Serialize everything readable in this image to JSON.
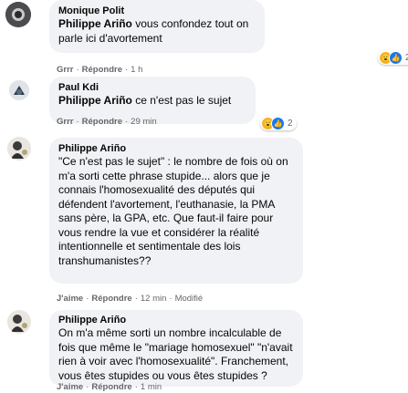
{
  "comments": [
    {
      "author": "Monique Polit",
      "mention": "Philippe Ariño",
      "text": " vous confondez tout on parle ici d'avortement",
      "actions": {
        "like": "Grrr",
        "reply": "Répondre",
        "time": "1 h"
      },
      "reaction_count": "2"
    },
    {
      "author": "Paul Kdi",
      "mention": "Philippe Ariño",
      "text": " ce n'est pas le sujet",
      "actions": {
        "like": "Grrr",
        "reply": "Répondre",
        "time": "29 min"
      },
      "reaction_count": "2"
    },
    {
      "author": "Philippe Ariño",
      "text": "\"Ce n'est pas le sujet\" : le nombre de fois où on m'a sorti cette phrase stupide... alors que je connais l'homosexualité des députés qui défendent l'avortement, l'euthanasie, la PMA sans père, la GPA, etc. Que faut-il faire pour vous rendre la vue et considérer la réalité intentionnelle et sentimentale des lois transhumanistes??",
      "actions": {
        "like": "J'aime",
        "reply": "Répondre",
        "time": "12 min",
        "edited": "Modifié"
      }
    },
    {
      "author": "Philippe Ariño",
      "text": "On m'a même sorti un nombre incalculable de fois que même le \"mariage homosexuel\" \"n'avait rien à voir avec l'homosexualité\". Franchement, vous êtes stupides ou vous êtes stupides ?",
      "actions": {
        "like": "J'aime",
        "reply": "Répondre",
        "time": "1 min"
      }
    }
  ],
  "icons": {
    "reaction_wow": "wow-emoji-icon",
    "reaction_like": "thumbs-up-icon"
  },
  "colors": {
    "bubble": "#f0f2f5",
    "meta_text": "#65676b",
    "like_blue": "#1877f2",
    "wow_yellow": "#f7b125"
  }
}
